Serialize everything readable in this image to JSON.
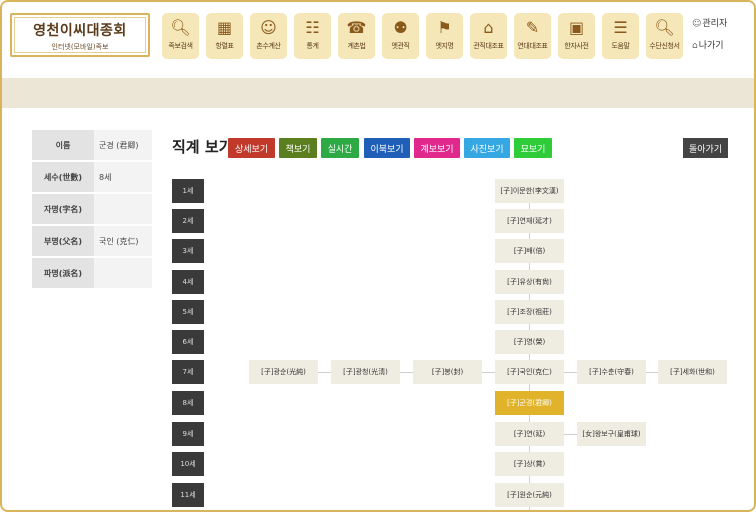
{
  "header": {
    "logo_title": "영천이씨대종회",
    "logo_subtitle": "인터넷(모바일)족보",
    "menu": [
      {
        "label": "족보검색",
        "icon": "search-icon"
      },
      {
        "label": "항렬표",
        "icon": "grid-icon"
      },
      {
        "label": "촌수계산",
        "icon": "people-icon"
      },
      {
        "label": "통계",
        "icon": "chart-icon"
      },
      {
        "label": "계촌법",
        "icon": "phone-icon"
      },
      {
        "label": "엣관직",
        "icon": "group-icon"
      },
      {
        "label": "엣지명",
        "icon": "map-icon"
      },
      {
        "label": "관직대조표",
        "icon": "building-icon"
      },
      {
        "label": "연대대조표",
        "icon": "brush-icon"
      },
      {
        "label": "한자사전",
        "icon": "dictionary-icon"
      },
      {
        "label": "도움말",
        "icon": "book-icon"
      },
      {
        "label": "수단신청서",
        "icon": "search-icon"
      }
    ],
    "admin_label": "관리자",
    "logout_label": "나가기"
  },
  "info": [
    {
      "label": "이름",
      "value": "군경 (君卿)"
    },
    {
      "label": "세수(世數)",
      "value": "8세"
    },
    {
      "label": "자명(字名)",
      "value": ""
    },
    {
      "label": "부명(父名)",
      "value": "국인 (克仁)"
    },
    {
      "label": "파명(派名)",
      "value": ""
    }
  ],
  "title": "직계 보기",
  "buttons": [
    {
      "label": "상세보기",
      "color": "#c0392b"
    },
    {
      "label": "책보기",
      "color": "#5b7f1e"
    },
    {
      "label": "실시간",
      "color": "#2eaa44"
    },
    {
      "label": "이북보기",
      "color": "#1f5fb8"
    },
    {
      "label": "계보보기",
      "color": "#e0288d"
    },
    {
      "label": "사진보기",
      "color": "#35a8e4"
    },
    {
      "label": "묘보기",
      "color": "#2fcc3a"
    }
  ],
  "back_label": "돌아가기",
  "generations": [
    "1세",
    "2세",
    "3세",
    "4세",
    "5세",
    "6세",
    "7세",
    "8세",
    "9세",
    "10세",
    "11세"
  ],
  "tree": {
    "main": [
      "[子]이문한(李文漢)",
      "[子]연재(延才)",
      "[子]배(倍)",
      "[子]유상(有尙)",
      "[子]조장(祖莊)",
      "[子]영(榮)",
      "[子]국인(克仁)",
      "[子]군경(君卿)",
      "[子]연(延)",
      "[子]상(賞)",
      "[子]원순(元純)"
    ],
    "siblings_left": [
      "[子]광순(光純)",
      "[子]광청(光淸)",
      "[子]봉(封)"
    ],
    "siblings_right": [
      "[子]수춘(守春)",
      "[子]세화(世和)"
    ],
    "spouse": "[女]왕보구(皇甫球)"
  }
}
